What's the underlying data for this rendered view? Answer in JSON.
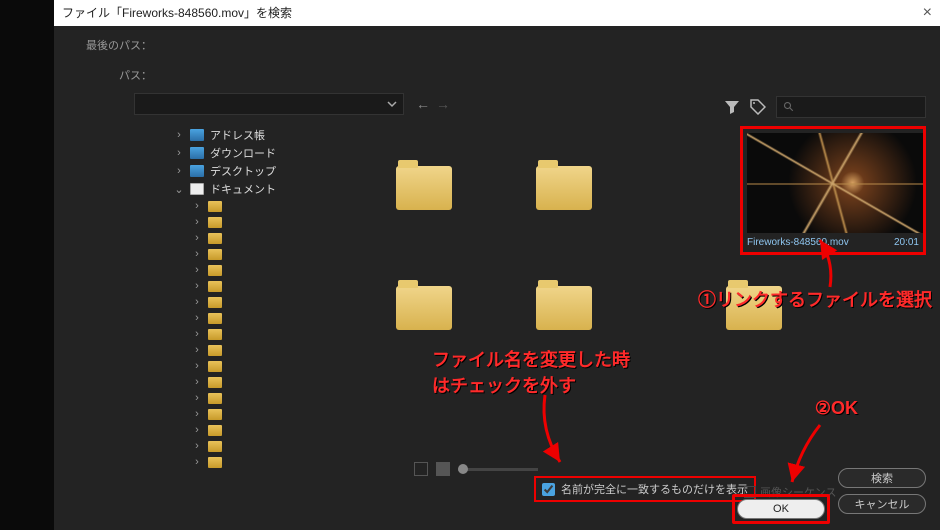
{
  "window": {
    "title": "ファイル「Fireworks-848560.mov」を検索"
  },
  "path": {
    "last_label": "最後のパス：",
    "path_label": "パス："
  },
  "tree": {
    "items": [
      {
        "label": "アドレス帳",
        "icon": "blue",
        "chev": ">"
      },
      {
        "label": "ダウンロード",
        "icon": "blue",
        "chev": ">"
      },
      {
        "label": "デスクトップ",
        "icon": "blue",
        "chev": ">"
      },
      {
        "label": "ドキュメント",
        "icon": "doc",
        "chev": "v"
      }
    ]
  },
  "video": {
    "name": "Fireworks-848560.mov",
    "duration": "20:01"
  },
  "checkbox": {
    "exact_match": "名前が完全に一致するものだけを表示",
    "image_sequence": "画像シーケンス"
  },
  "buttons": {
    "search": "検索",
    "ok": "OK",
    "cancel": "キャンセル"
  },
  "annotations": {
    "select_file": "①リンクするファイルを選択",
    "uncheck": "ファイル名を変更した時\nはチェックを外す",
    "ok": "②OK"
  }
}
